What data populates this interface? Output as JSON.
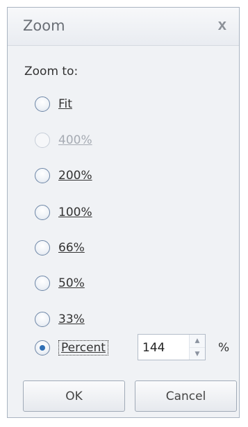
{
  "dialog": {
    "title": "Zoom",
    "close_glyph": "x"
  },
  "zoom_to_label": "Zoom to:",
  "options": [
    {
      "label": "Fit",
      "selected": false,
      "enabled": true
    },
    {
      "label": "400%",
      "selected": false,
      "enabled": false
    },
    {
      "label": "200%",
      "selected": false,
      "enabled": true
    },
    {
      "label": "100%",
      "selected": false,
      "enabled": true
    },
    {
      "label": "66%",
      "selected": false,
      "enabled": true
    },
    {
      "label": "50%",
      "selected": false,
      "enabled": true
    },
    {
      "label": "33%",
      "selected": false,
      "enabled": true
    },
    {
      "label": "Percent",
      "selected": true,
      "enabled": true
    }
  ],
  "percent": {
    "value": "144",
    "unit": "%"
  },
  "buttons": {
    "ok": "OK",
    "cancel": "Cancel"
  },
  "icons": {
    "close": "close-icon",
    "spin_up": "chevron-up-icon",
    "spin_down": "chevron-down-icon"
  }
}
